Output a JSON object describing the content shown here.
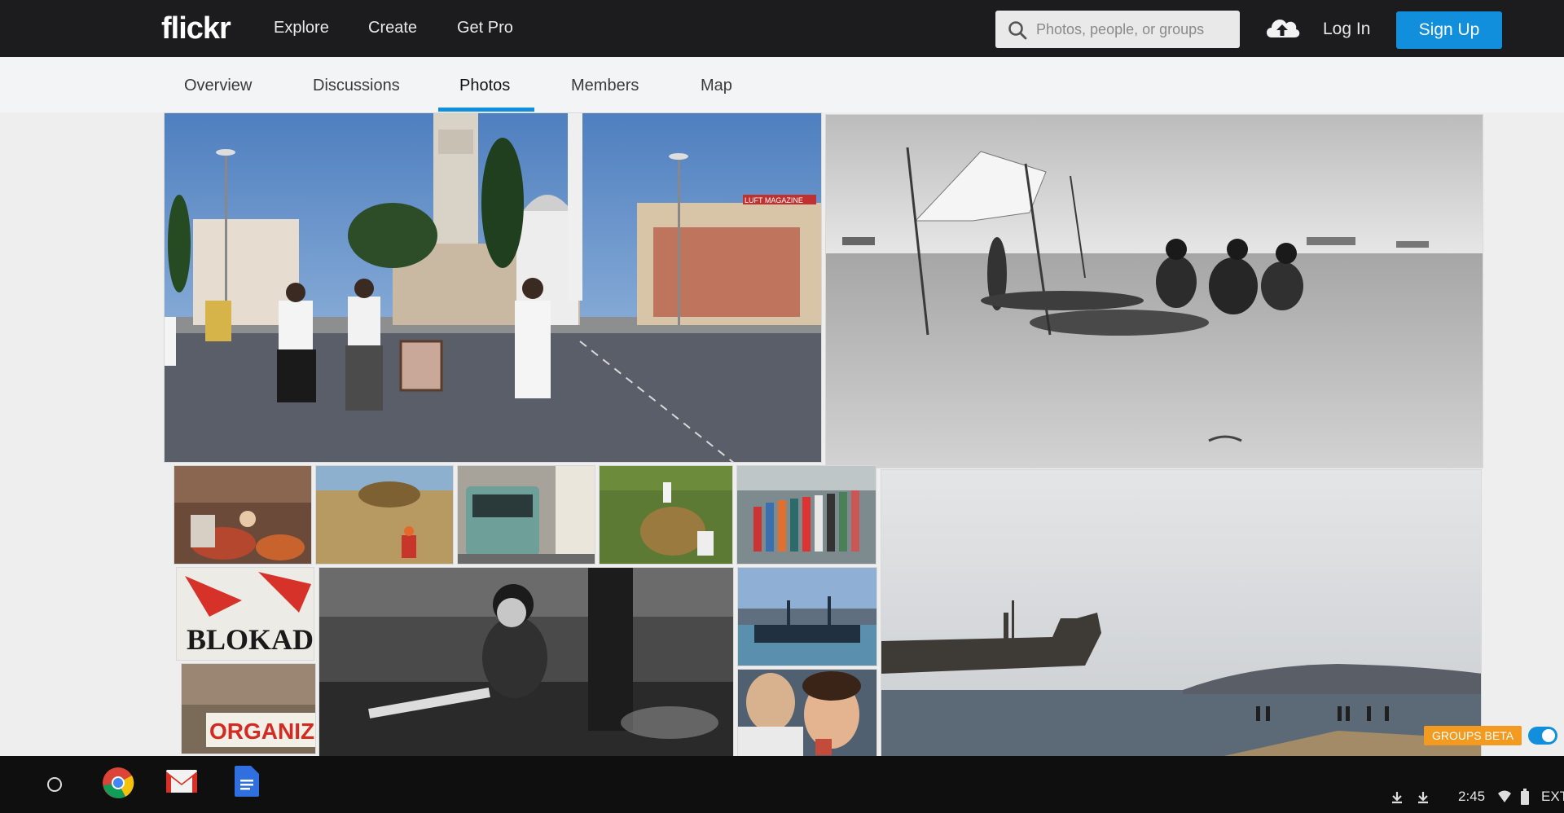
{
  "header": {
    "logo_text": "flickr",
    "nav": [
      "Explore",
      "Create",
      "Get Pro"
    ],
    "search_placeholder": "Photos, people, or groups",
    "login_label": "Log In",
    "signup_label": "Sign Up"
  },
  "tabs": {
    "items": [
      "Overview",
      "Discussions",
      "Photos",
      "Members",
      "Map"
    ],
    "active": "Photos"
  },
  "photos": {
    "banner_sign": "LUFT MAGAZINE",
    "poster_text_1": "BLOKADE",
    "poster_text_2": "ORGANIZ"
  },
  "footer": {
    "groups_beta_label": "GROUPS BETA",
    "groups_beta_toggle_on": true
  },
  "taskbar": {
    "time": "2:45",
    "ext_label": "EXT"
  },
  "colors": {
    "accent": "#128fdc",
    "beta_badge": "#f39a20",
    "topbar": "#1c1c1f"
  }
}
